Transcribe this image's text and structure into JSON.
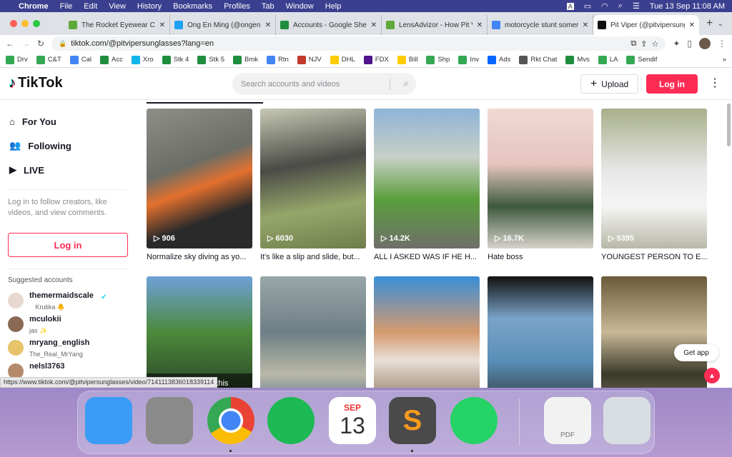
{
  "menubar": {
    "app": "Chrome",
    "items": [
      "File",
      "Edit",
      "View",
      "History",
      "Bookmarks",
      "Profiles",
      "Tab",
      "Window",
      "Help"
    ],
    "input_badge": "A",
    "datetime": "Tue 13 Sep  11:08 AM"
  },
  "tabs": [
    {
      "title": "The Rocket Eyewear Co",
      "color": "#5fa83a"
    },
    {
      "title": "Ong En Ming (@ongenming",
      "color": "#1da1f2"
    },
    {
      "title": "Accounts - Google Sheets",
      "color": "#1e8e3e"
    },
    {
      "title": "LensAdvizor - How Pit Viper",
      "color": "#5fa83a"
    },
    {
      "title": "motorcycle stunt somersault",
      "color": "#4285f4"
    },
    {
      "title": "Pit Viper (@pitvipersunglasses)",
      "color": "#111111"
    }
  ],
  "address": {
    "url": "tiktok.com/@pitvipersunglasses?lang=en"
  },
  "bookmarks": [
    {
      "label": "Drv",
      "color": "#34a853"
    },
    {
      "label": "C&T",
      "color": "#34a853"
    },
    {
      "label": "Cal",
      "color": "#4285f4"
    },
    {
      "label": "Acc",
      "color": "#1e8e3e"
    },
    {
      "label": "Xro",
      "color": "#13b5ea"
    },
    {
      "label": "Stk 4",
      "color": "#1e8e3e"
    },
    {
      "label": "Stk 5",
      "color": "#1e8e3e"
    },
    {
      "label": "Bmk",
      "color": "#1e8e3e"
    },
    {
      "label": "Rtn",
      "color": "#4285f4"
    },
    {
      "label": "NJV",
      "color": "#c0392b"
    },
    {
      "label": "DHL",
      "color": "#ffcc00"
    },
    {
      "label": "FDX",
      "color": "#4d148c"
    },
    {
      "label": "Bill",
      "color": "#ffcc00"
    },
    {
      "label": "Shp",
      "color": "#34a853"
    },
    {
      "label": "Inv",
      "color": "#34a853"
    },
    {
      "label": "Ads",
      "color": "#0866ff"
    },
    {
      "label": "Rkt Chat",
      "color": "#555555"
    },
    {
      "label": "Mvs",
      "color": "#1e8e3e"
    },
    {
      "label": "LA",
      "color": "#34a853"
    },
    {
      "label": "Sendif",
      "color": "#34a853"
    }
  ],
  "tiktok": {
    "logo": "TikTok",
    "search_placeholder": "Search accounts and videos",
    "upload": "Upload",
    "login": "Log in",
    "nav": [
      {
        "label": "For You",
        "icon": "home-icon"
      },
      {
        "label": "Following",
        "icon": "users-icon"
      },
      {
        "label": "LIVE",
        "icon": "live-icon"
      }
    ],
    "hint": "Log in to follow creators, like videos, and view comments.",
    "side_login": "Log in",
    "suggested_title": "Suggested accounts",
    "accounts": [
      {
        "name": "themermaidscale",
        "sub": "Krutika 🐥",
        "verified": true,
        "color": "#e8d9d0"
      },
      {
        "name": "mculokii",
        "sub": "jas ✨",
        "verified": false,
        "color": "#8a6a55"
      },
      {
        "name": "mryang_english",
        "sub": "The_Real_MrYang",
        "verified": false,
        "color": "#e7c36a"
      },
      {
        "name": "nelsl3763",
        "sub": "",
        "verified": false,
        "color": "#b58a6a"
      }
    ],
    "videos": [
      {
        "views": "906",
        "caption": "Normalize sky diving as yo...",
        "bg": "linear-gradient(160deg,#8d8f88,#6b6e66 40%,#e3702e 55%,#2a2a2a 75%)"
      },
      {
        "views": "6030",
        "caption": "It's like a slip and slide, but...",
        "bg": "linear-gradient(170deg,#c7c9b3,#4b4b47 40%,#96a66a 70%,#6f7d4a)"
      },
      {
        "views": "14.2K",
        "caption": "ALL I ASKED WAS IF HE H...",
        "bg": "linear-gradient(180deg,#8fb4d8,#c8d0c6 35%,#5a9e3c 65%,#6f6f6a)"
      },
      {
        "views": "16.7K",
        "caption": "Hate boss",
        "bg": "linear-gradient(180deg,#f0d9d3,#e5c4be 40%,#3d5a3d 70%,#d8d2cc)"
      },
      {
        "views": "5395",
        "caption": "YOUNGEST PERSON TO E...",
        "bg": "linear-gradient(180deg,#a8b08a,#e8e8e8 45%,#f5f5f5 70%,#b8b8a8)"
      },
      {
        "views": "",
        "caption": "",
        "bg": "linear-gradient(180deg,#6fa0d8,#4b8a3a 40%,#2f4a2a 80%)",
        "warning": "Participating in this activity could result in you or others getting"
      },
      {
        "views": "",
        "caption": "",
        "bg": "linear-gradient(180deg,#9aa6a8,#6d7f86 40%,#b9b8a6 70%,#3b5d8d)"
      },
      {
        "views": "",
        "caption": "",
        "bg": "linear-gradient(180deg,#3a8ed8,#d59a6e 40%,#e8e0d8 60%,#7a5a3a)"
      },
      {
        "views": "",
        "caption": "",
        "bg": "linear-gradient(180deg,#111,#7aa3c8 30%,#5a8fb8 60%,#2a2a2a)"
      },
      {
        "views": "",
        "caption": "",
        "bg": "linear-gradient(180deg,#6a5a3a,#c8b898 40%,#3a3a2a 70%,#8a7a6a)"
      }
    ],
    "get_app": "Get app"
  },
  "status_url": "https://www.tiktok.com/@pitvipersunglasses/video/7141113836018339114",
  "dock": [
    {
      "name": "Finder",
      "color": "#3b9cf5"
    },
    {
      "name": "System Preferences",
      "color": "#8a8a8a"
    },
    {
      "name": "Chrome",
      "color": "#ffffff"
    },
    {
      "name": "Spotify",
      "color": "#1db954"
    },
    {
      "name": "Calendar",
      "color": "#ffffff",
      "month": "SEP",
      "day": "13"
    },
    {
      "name": "Sublime Text",
      "color": "#4a4a4a"
    },
    {
      "name": "WhatsApp",
      "color": "#25d366"
    },
    {
      "name": "PDF",
      "color": "#f2f2f2",
      "label": "PDF"
    },
    {
      "name": "Trash",
      "color": "#d8dde2"
    }
  ]
}
